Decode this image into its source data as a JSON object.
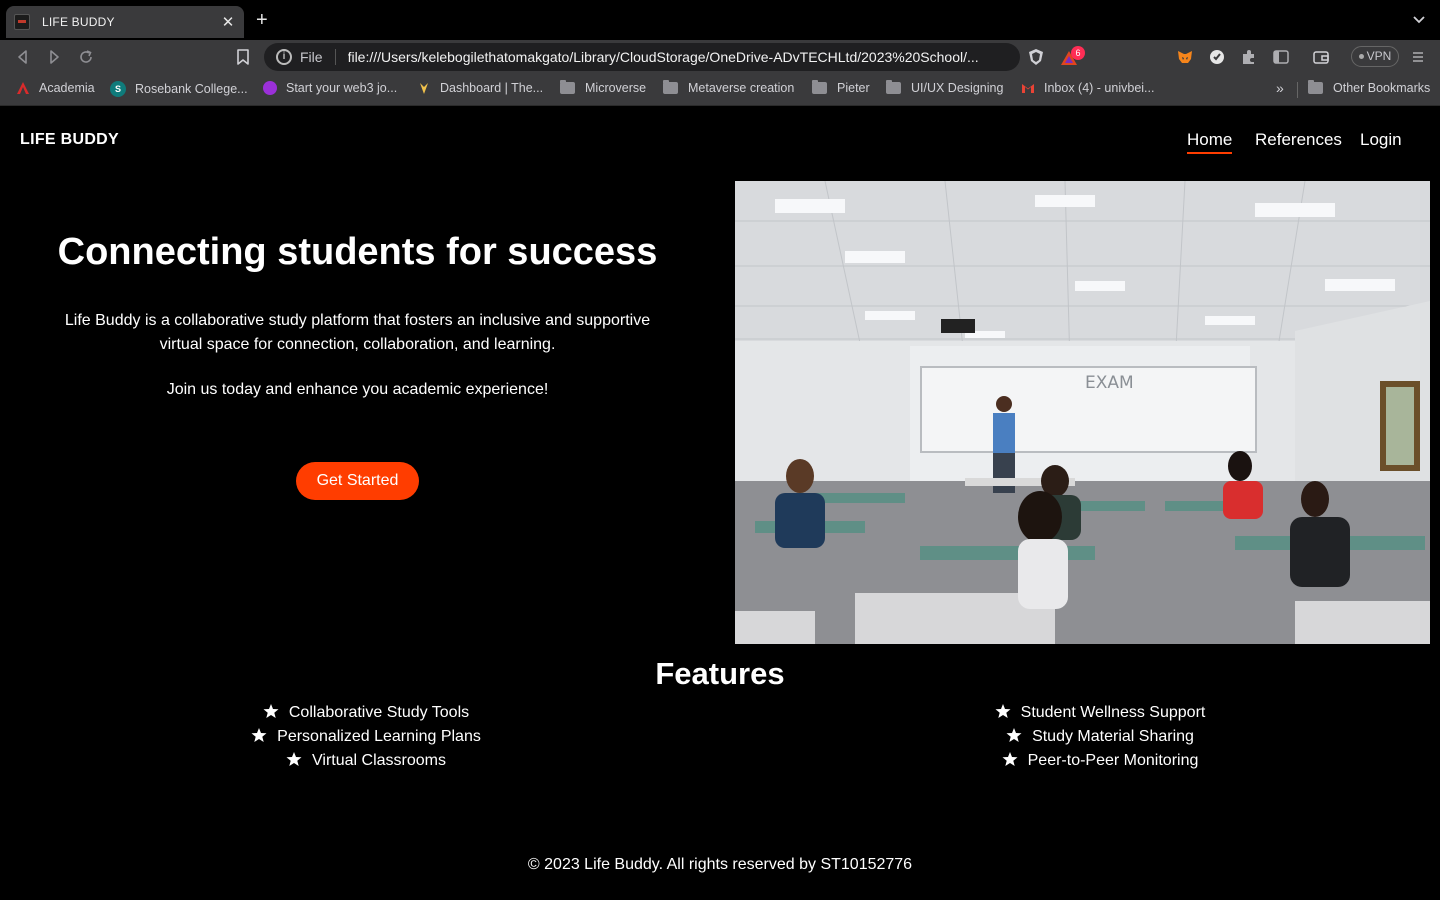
{
  "browser": {
    "tab": {
      "title": "LIFE BUDDY"
    },
    "address": {
      "scheme_label": "File",
      "url": "file:///Users/kelebogilethatomakgato/Library/CloudStorage/OneDrive-ADvTECHLtd/2023%20School/..."
    },
    "shield_badge": "6",
    "vpn_label": "VPN",
    "bookmarks": [
      {
        "label": "Academia",
        "icon": "academia-icon"
      },
      {
        "label": "Rosebank College...",
        "icon": "sharepoint-icon"
      },
      {
        "label": "Start your web3 jo...",
        "icon": "web3-icon"
      },
      {
        "label": "Dashboard | The...",
        "icon": "dashboard-icon"
      },
      {
        "label": "Microverse",
        "icon": "folder-icon"
      },
      {
        "label": "Metaverse creation",
        "icon": "folder-icon"
      },
      {
        "label": "Pieter",
        "icon": "folder-icon"
      },
      {
        "label": "UI/UX Designing",
        "icon": "folder-icon"
      },
      {
        "label": "Inbox (4) - univbei...",
        "icon": "gmail-icon"
      }
    ],
    "other_bookmarks": "Other Bookmarks"
  },
  "site": {
    "logo": "LIFE BUDDY",
    "nav": [
      {
        "label": "Home",
        "active": true
      },
      {
        "label": "References",
        "active": false
      },
      {
        "label": "Login",
        "active": false
      }
    ],
    "hero": {
      "title": "Connecting students for success",
      "description": "Life Buddy is a collaborative study platform that fosters an inclusive and supportive virtual space for connection, collaboration, and learning.",
      "join": "Join us today and enhance you academic experience!",
      "cta": "Get Started",
      "image_text": "EXAM"
    },
    "features": {
      "title": "Features",
      "left": [
        "Collaborative Study Tools",
        "Personalized Learning Plans",
        "Virtual Classrooms"
      ],
      "right": [
        "Student Wellness Support",
        "Study Material Sharing",
        "Peer-to-Peer Monitoring"
      ]
    },
    "footer": "© 2023 Life Buddy. All rights reserved by ST10152776"
  },
  "colors": {
    "accent": "#ff3d00",
    "background": "#000000",
    "chrome": "#3a3a3c"
  }
}
